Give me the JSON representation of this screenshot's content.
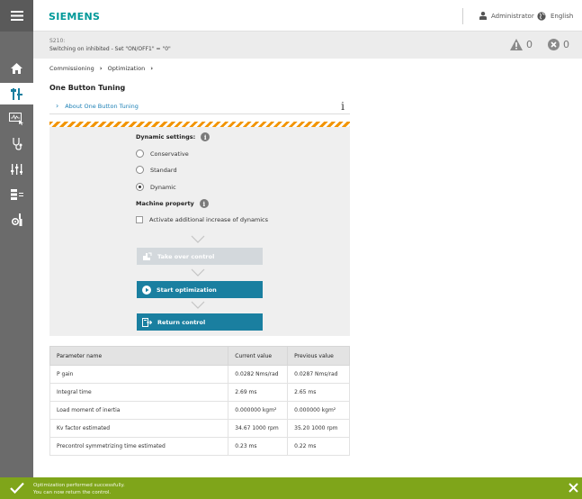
{
  "header": {
    "brand": "SIEMENS",
    "user": "Administrator",
    "language": "English"
  },
  "status": {
    "code": "S210:",
    "message": "Switching on inhibited - Set \"ON/OFF1\" = \"0\"",
    "warnings": "0",
    "errors": "0"
  },
  "breadcrumb": {
    "items": [
      "Commissioning",
      "Optimization"
    ]
  },
  "page": {
    "title": "One Button Tuning",
    "about_label": "About One Button Tuning",
    "about_icon": "i"
  },
  "settings": {
    "dynamic_label": "Dynamic settings:",
    "options": [
      "Conservative",
      "Standard",
      "Dynamic"
    ],
    "selected": "Dynamic",
    "machine_label": "Machine property",
    "checkbox_label": "Activate additional increase of dynamics",
    "checkbox_checked": false
  },
  "actions": {
    "take_over": "Take over control",
    "start": "Start optimization",
    "return": "Return control"
  },
  "table": {
    "headers": [
      "Parameter name",
      "Current value",
      "Previous value"
    ],
    "rows": [
      [
        "P gain",
        "0.0282 Nms/rad",
        "0.0287 Nms/rad"
      ],
      [
        "Integral time",
        "2.69 ms",
        "2.65 ms"
      ],
      [
        "Load moment of inertia",
        "0.000000 kgm²",
        "0.000000 kgm²"
      ],
      [
        "Kv factor estimated",
        "34.67 1000 rpm",
        "35.20 1000 rpm"
      ],
      [
        "Precontrol symmetrizing time estimated",
        "0.23 ms",
        "0.22 ms"
      ]
    ]
  },
  "footer": {
    "line1": "Optimization performed successfully.",
    "line2": "You can now return the control."
  },
  "colors": {
    "brand": "#009999",
    "accent": "#1a7fa0",
    "success": "#7fa51a",
    "hazard": "#f29400"
  },
  "icons": {
    "rail": [
      "menu-icon",
      "home-icon",
      "commissioning-icon",
      "trace-icon",
      "diagnostics-icon",
      "parameters-icon",
      "database-icon",
      "settings-tools-icon"
    ]
  }
}
